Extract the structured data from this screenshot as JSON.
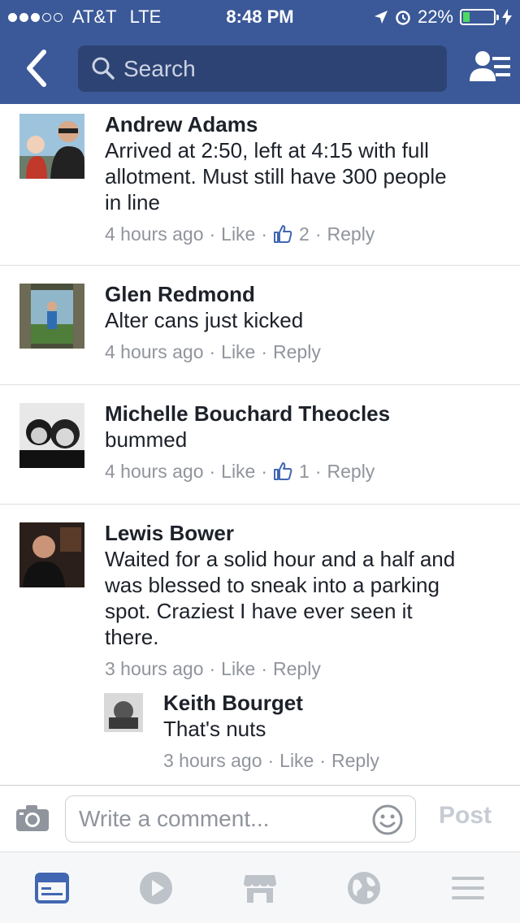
{
  "status_bar": {
    "carrier": "AT&T",
    "network": "LTE",
    "time": "8:48 PM",
    "battery_percent": "22%",
    "battery_level": 0.22
  },
  "nav": {
    "search_placeholder": "Search",
    "back_icon": "chevron-left-icon",
    "friends_icon": "friends-list-icon"
  },
  "comments": [
    {
      "name": "Andrew Adams",
      "text_lines": [
        "Arrived at 2:50, left at 4:15 with full",
        "allotment. Must still have 300 people",
        "in line"
      ],
      "time": "4 hours ago",
      "like": "Like",
      "reactions": "2",
      "reply": "Reply"
    },
    {
      "name": "Glen Redmond",
      "text_lines": [
        "Alter cans just kicked"
      ],
      "time": "4 hours ago",
      "like": "Like",
      "reply": "Reply"
    },
    {
      "name": "Michelle Bouchard Theocles",
      "text_lines": [
        "bummed"
      ],
      "time": "4 hours ago",
      "like": "Like",
      "reactions": "1",
      "reply": "Reply"
    },
    {
      "name": "Lewis Bower",
      "text_lines": [
        "Waited for a solid hour and a half and",
        "was blessed to sneak into a parking",
        "spot. Craziest I have ever seen it",
        "there."
      ],
      "time": "3 hours ago",
      "like": "Like",
      "reply": "Reply",
      "replies": [
        {
          "name": "Keith Bourget",
          "text_lines": [
            "That's nuts"
          ],
          "time": "3 hours ago",
          "like": "Like",
          "reply": "Reply"
        }
      ]
    }
  ],
  "composer": {
    "placeholder": "Write a comment...",
    "post_label": "Post"
  },
  "tabs": [
    "news-feed-icon",
    "video-icon",
    "marketplace-icon",
    "notifications-globe-icon",
    "menu-icon"
  ],
  "colors": {
    "brand_blue": "#3b5998",
    "search_bg": "#2d4373",
    "active_tab": "#4267b2",
    "meta_gray": "#90949c"
  }
}
